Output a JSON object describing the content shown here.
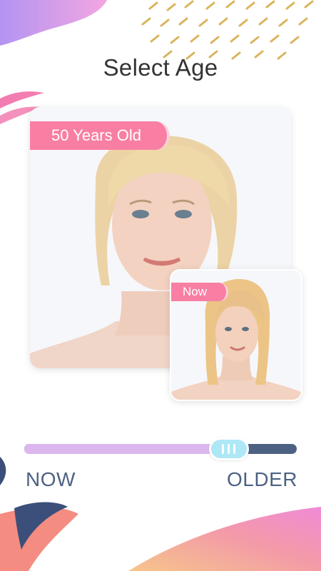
{
  "title": "Select Age",
  "main_photo": {
    "tag_label": "50 Years Old",
    "subject": "older blonde woman portrait"
  },
  "now_photo": {
    "tag_label": "Now",
    "subject": "young blonde woman portrait"
  },
  "slider": {
    "min_label": "NOW",
    "max_label": "OLDER",
    "value_fraction": 0.75
  },
  "colors": {
    "tag_pink": "#f87fa3",
    "track_dark": "#4d6283",
    "track_fill": "#dcb7ef",
    "thumb": "#aee7f5",
    "title_text": "#333333"
  }
}
